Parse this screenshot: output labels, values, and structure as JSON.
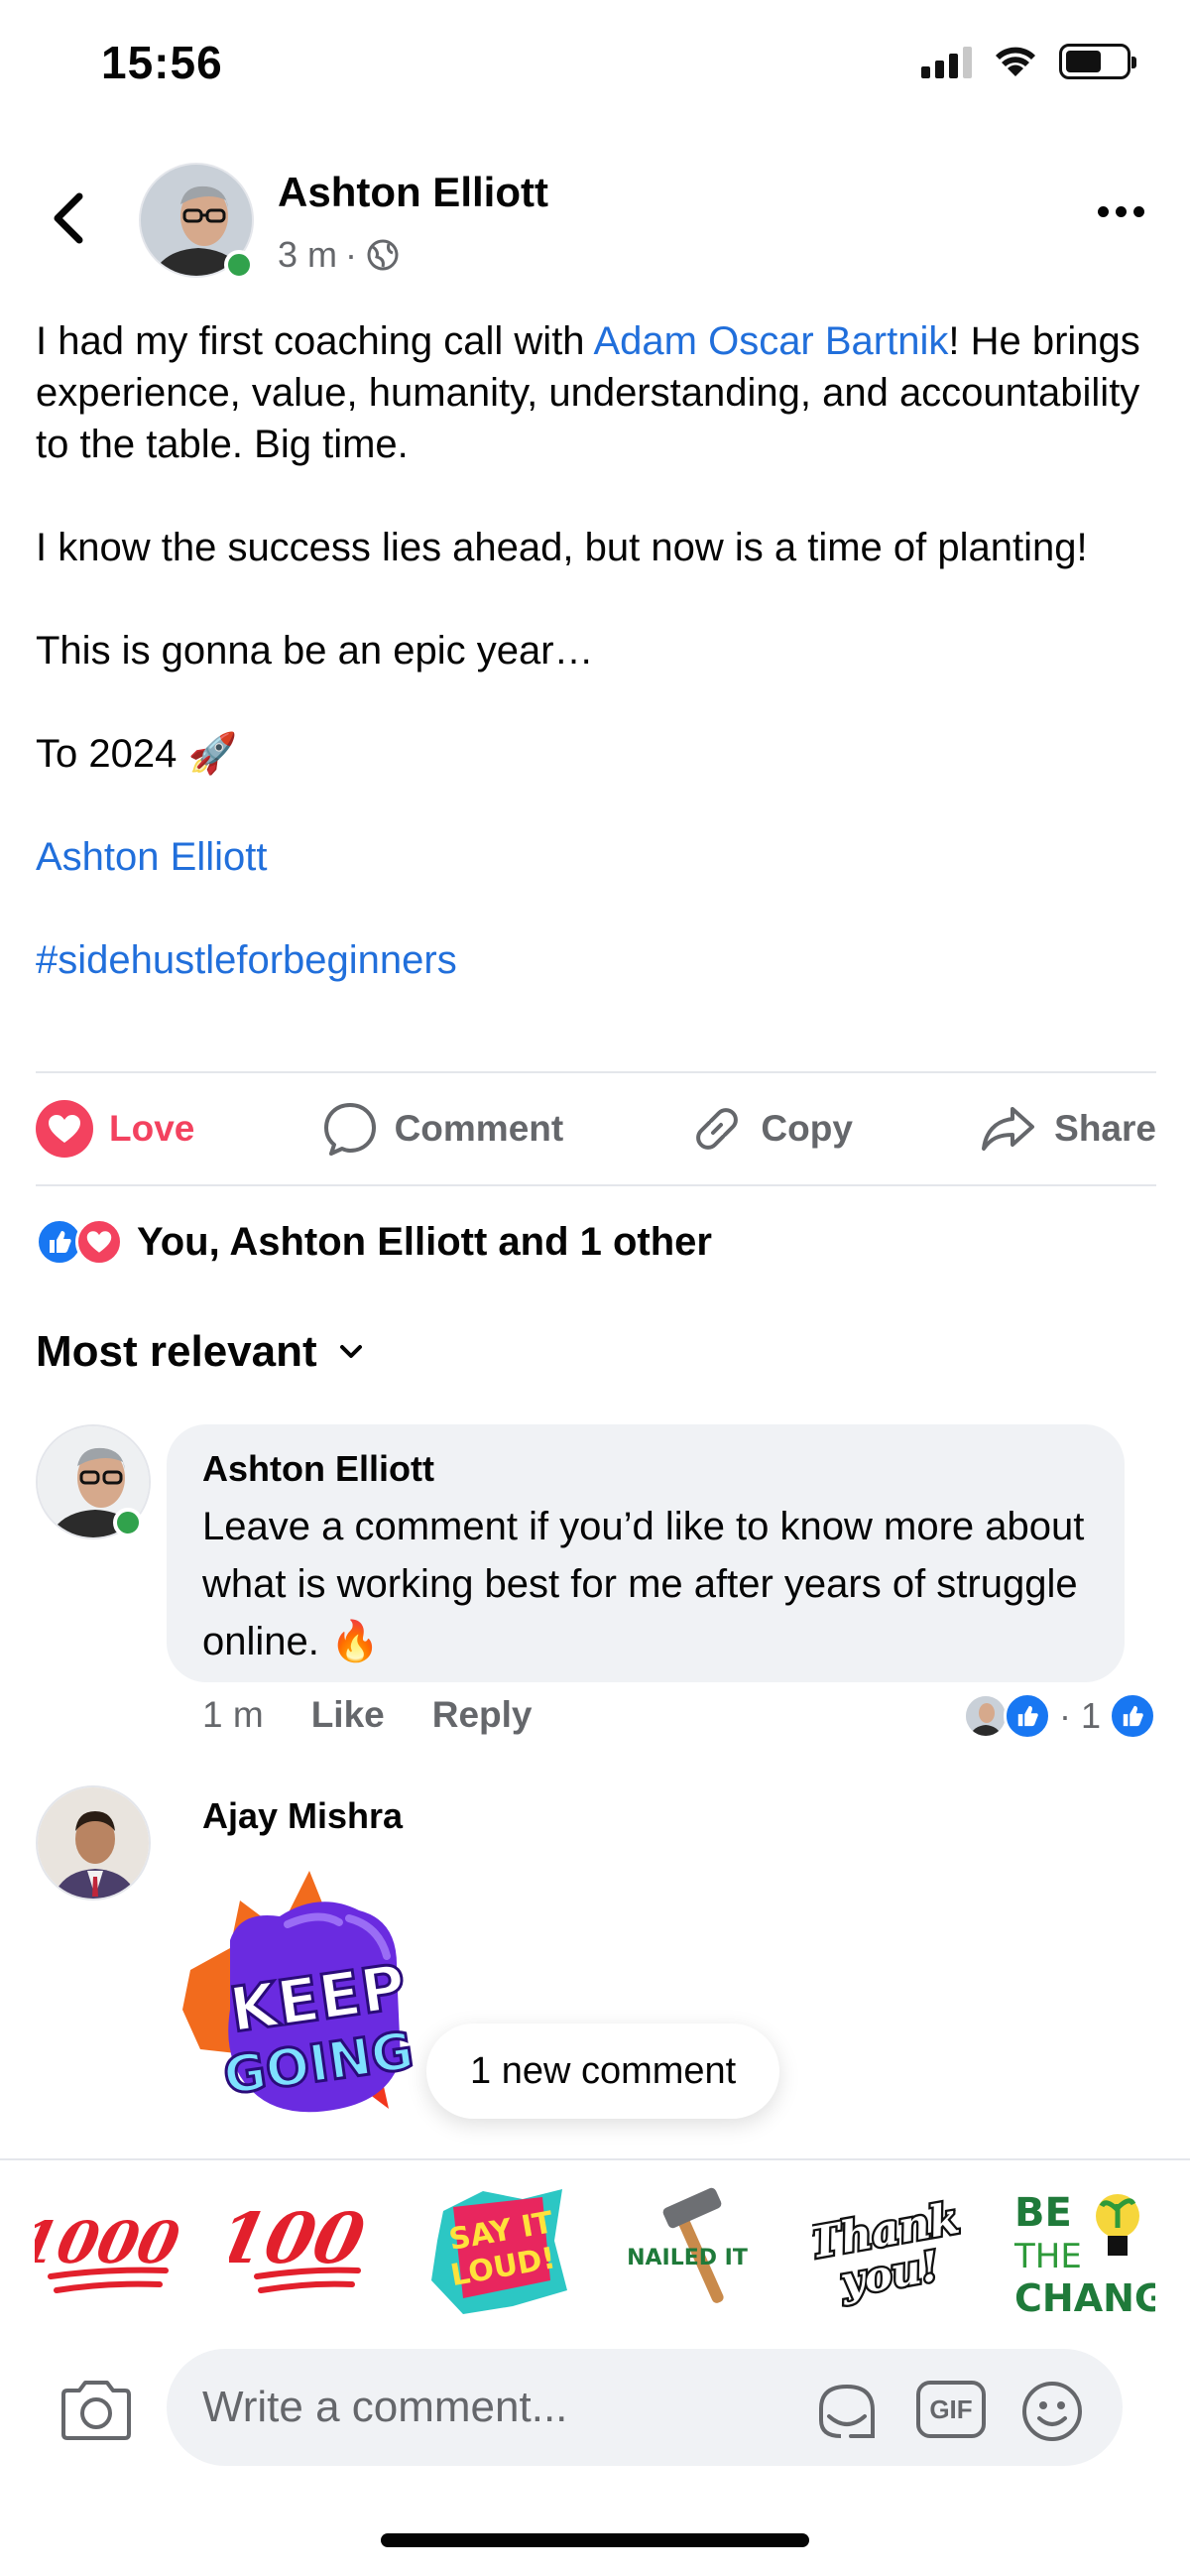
{
  "status_bar": {
    "time": "15:56"
  },
  "post": {
    "author": "Ashton Elliott",
    "time": "3 m",
    "meta_separator": "·",
    "paragraph1_before": "I had my first coaching call with ",
    "paragraph1_mention": "Adam Oscar Bartnik",
    "paragraph1_after": "! He brings experience, value, humanity, understanding, and accountability to the table. Big time.",
    "paragraph2": "I know the success lies ahead, but now is a time of planting!",
    "paragraph3": "This is gonna be an epic year…",
    "paragraph4": "To 2024 🚀",
    "mention_link": "Ashton Elliott",
    "hashtag": "#sidehustleforbeginners"
  },
  "actions": {
    "love": "Love",
    "comment": "Comment",
    "copy": "Copy",
    "share": "Share"
  },
  "reactions_summary": "You, Ashton Elliott and 1 other",
  "sort_label": "Most relevant",
  "comments": [
    {
      "author": "Ashton Elliott",
      "text": "Leave a comment if you’d like to know more about what is working best for me after years of struggle online. 🔥",
      "time": "1 m",
      "like_label": "Like",
      "reply_label": "Reply",
      "reaction_count": "· 1"
    },
    {
      "author": "Ajay Mishra",
      "sticker_line1": "KEEP",
      "sticker_line2": "GOING"
    }
  ],
  "new_comment_pill": "1 new comment",
  "sticker_tray": [
    {
      "name": "sticker-1000",
      "text": "1000"
    },
    {
      "name": "sticker-100",
      "text": "100"
    },
    {
      "name": "sticker-say-it-loud",
      "line1": "SAY IT",
      "line2": "LOUD!"
    },
    {
      "name": "sticker-nailed-it",
      "text": "NAILED IT"
    },
    {
      "name": "sticker-thank-you",
      "line1": "Thank",
      "line2": "you!"
    },
    {
      "name": "sticker-be-the-change",
      "line1": "BE",
      "line2": "THE",
      "line3": "CHANGE"
    }
  ],
  "composer": {
    "placeholder": "Write a comment...",
    "gif_label": "GIF"
  },
  "colors": {
    "link": "#216fdb",
    "love": "#f3425f",
    "like": "#1877f2",
    "online": "#31a24c",
    "muted": "#65676b"
  }
}
